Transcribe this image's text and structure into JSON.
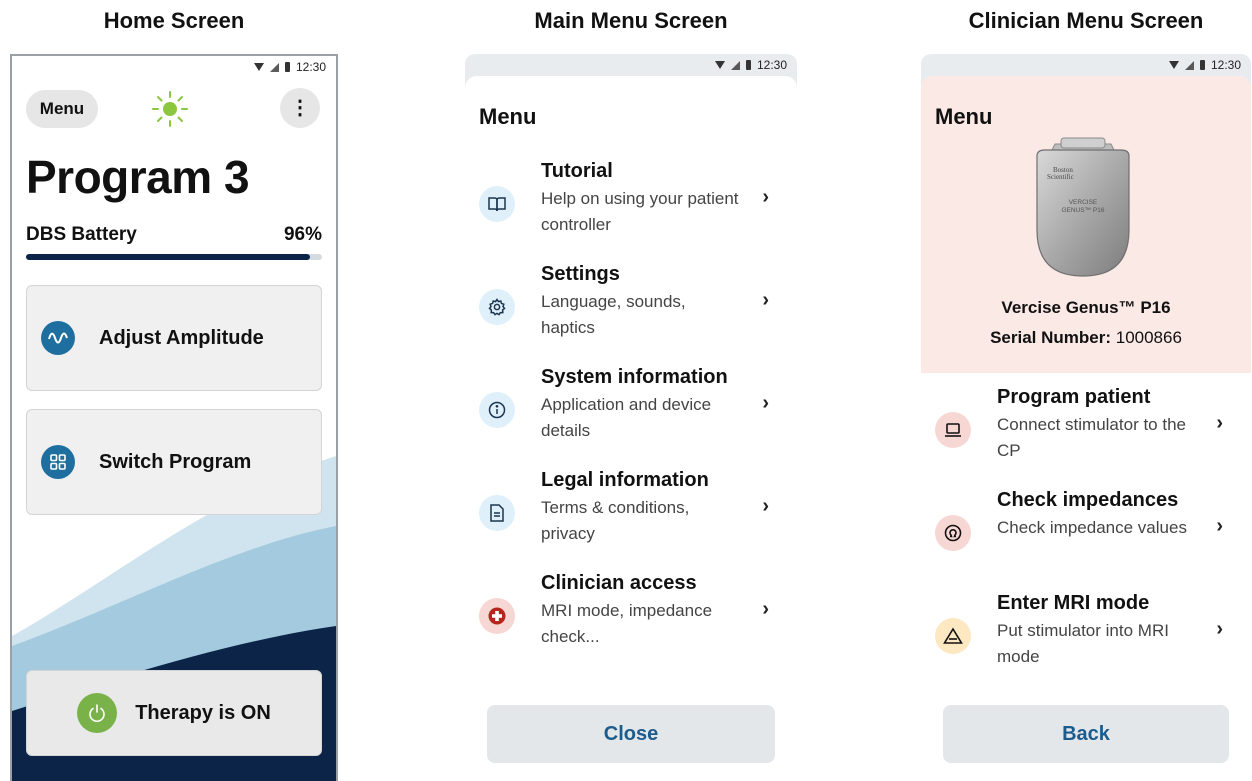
{
  "captions": {
    "home": "Home Screen",
    "main_menu": "Main Menu Screen",
    "clinician_menu": "Clinician Menu Screen"
  },
  "status_bar": {
    "time": "12:30"
  },
  "home": {
    "menu_button": "Menu",
    "more_icon": "⋮",
    "program_title": "Program 3",
    "battery_label": "DBS Battery",
    "battery_percent": "96%",
    "battery_level": 0.96,
    "adjust_amplitude": "Adjust Amplitude",
    "switch_program": "Switch Program",
    "therapy_status": "Therapy is ON",
    "colors": {
      "accent": "#1e6fa0",
      "navy": "#0b2447",
      "therapy_green": "#7ab24a",
      "sun_green": "#8cc63f"
    }
  },
  "main_menu": {
    "title": "Menu",
    "items": [
      {
        "title": "Tutorial",
        "subtitle": "Help on using your patient controller",
        "icon": "book-icon"
      },
      {
        "title": "Settings",
        "subtitle": "Language, sounds, haptics",
        "icon": "gear-icon"
      },
      {
        "title": "System information",
        "subtitle": "Application and device details",
        "icon": "info-icon"
      },
      {
        "title": "Legal information",
        "subtitle": "Terms & conditions, privacy",
        "icon": "document-icon"
      },
      {
        "title": "Clinician access",
        "subtitle": "MRI mode, impedance check...",
        "icon": "medical-cross-icon"
      }
    ],
    "close_button": "Close"
  },
  "clinician_menu": {
    "title": "Menu",
    "device_name": "Vercise Genus™ P16",
    "serial_label": "Serial Number",
    "serial_value": "1000866",
    "device_text": {
      "brand_line1": "Boston",
      "brand_line2": "Scientific",
      "model_line1": "VERCISE",
      "model_line2": "GENUS™ P16"
    },
    "items": [
      {
        "title": "Program patient",
        "subtitle": "Connect stimulator to the CP",
        "icon": "laptop-icon"
      },
      {
        "title": "Check impedances",
        "subtitle": "Check impedance values",
        "icon": "omega-icon"
      },
      {
        "title": "Enter MRI mode",
        "subtitle": "Put stimulator into MRI mode",
        "icon": "mri-warning-icon"
      }
    ],
    "back_button": "Back"
  },
  "chevron": "›"
}
